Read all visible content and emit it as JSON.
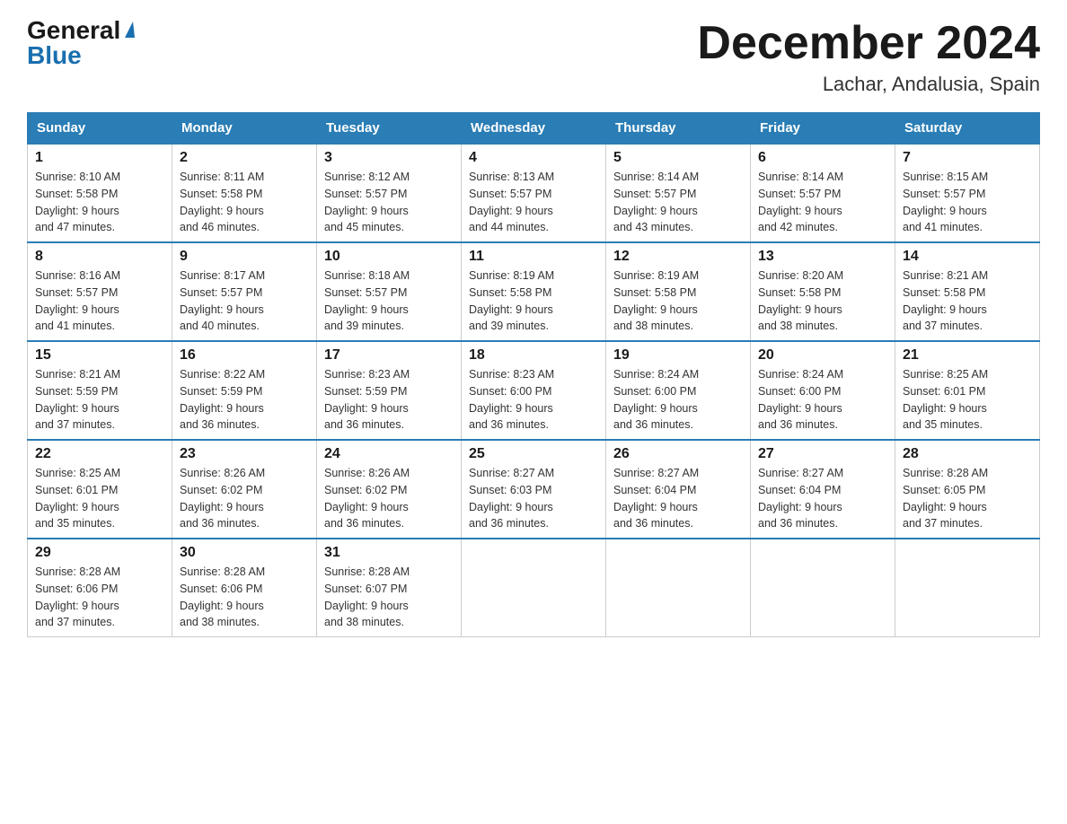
{
  "header": {
    "logo_general": "General",
    "logo_blue": "Blue",
    "month_title": "December 2024",
    "location": "Lachar, Andalusia, Spain"
  },
  "weekdays": [
    "Sunday",
    "Monday",
    "Tuesday",
    "Wednesday",
    "Thursday",
    "Friday",
    "Saturday"
  ],
  "weeks": [
    [
      {
        "day": "1",
        "sunrise": "8:10 AM",
        "sunset": "5:58 PM",
        "daylight": "9 hours and 47 minutes."
      },
      {
        "day": "2",
        "sunrise": "8:11 AM",
        "sunset": "5:58 PM",
        "daylight": "9 hours and 46 minutes."
      },
      {
        "day": "3",
        "sunrise": "8:12 AM",
        "sunset": "5:57 PM",
        "daylight": "9 hours and 45 minutes."
      },
      {
        "day": "4",
        "sunrise": "8:13 AM",
        "sunset": "5:57 PM",
        "daylight": "9 hours and 44 minutes."
      },
      {
        "day": "5",
        "sunrise": "8:14 AM",
        "sunset": "5:57 PM",
        "daylight": "9 hours and 43 minutes."
      },
      {
        "day": "6",
        "sunrise": "8:14 AM",
        "sunset": "5:57 PM",
        "daylight": "9 hours and 42 minutes."
      },
      {
        "day": "7",
        "sunrise": "8:15 AM",
        "sunset": "5:57 PM",
        "daylight": "9 hours and 41 minutes."
      }
    ],
    [
      {
        "day": "8",
        "sunrise": "8:16 AM",
        "sunset": "5:57 PM",
        "daylight": "9 hours and 41 minutes."
      },
      {
        "day": "9",
        "sunrise": "8:17 AM",
        "sunset": "5:57 PM",
        "daylight": "9 hours and 40 minutes."
      },
      {
        "day": "10",
        "sunrise": "8:18 AM",
        "sunset": "5:57 PM",
        "daylight": "9 hours and 39 minutes."
      },
      {
        "day": "11",
        "sunrise": "8:19 AM",
        "sunset": "5:58 PM",
        "daylight": "9 hours and 39 minutes."
      },
      {
        "day": "12",
        "sunrise": "8:19 AM",
        "sunset": "5:58 PM",
        "daylight": "9 hours and 38 minutes."
      },
      {
        "day": "13",
        "sunrise": "8:20 AM",
        "sunset": "5:58 PM",
        "daylight": "9 hours and 38 minutes."
      },
      {
        "day": "14",
        "sunrise": "8:21 AM",
        "sunset": "5:58 PM",
        "daylight": "9 hours and 37 minutes."
      }
    ],
    [
      {
        "day": "15",
        "sunrise": "8:21 AM",
        "sunset": "5:59 PM",
        "daylight": "9 hours and 37 minutes."
      },
      {
        "day": "16",
        "sunrise": "8:22 AM",
        "sunset": "5:59 PM",
        "daylight": "9 hours and 36 minutes."
      },
      {
        "day": "17",
        "sunrise": "8:23 AM",
        "sunset": "5:59 PM",
        "daylight": "9 hours and 36 minutes."
      },
      {
        "day": "18",
        "sunrise": "8:23 AM",
        "sunset": "6:00 PM",
        "daylight": "9 hours and 36 minutes."
      },
      {
        "day": "19",
        "sunrise": "8:24 AM",
        "sunset": "6:00 PM",
        "daylight": "9 hours and 36 minutes."
      },
      {
        "day": "20",
        "sunrise": "8:24 AM",
        "sunset": "6:00 PM",
        "daylight": "9 hours and 36 minutes."
      },
      {
        "day": "21",
        "sunrise": "8:25 AM",
        "sunset": "6:01 PM",
        "daylight": "9 hours and 35 minutes."
      }
    ],
    [
      {
        "day": "22",
        "sunrise": "8:25 AM",
        "sunset": "6:01 PM",
        "daylight": "9 hours and 35 minutes."
      },
      {
        "day": "23",
        "sunrise": "8:26 AM",
        "sunset": "6:02 PM",
        "daylight": "9 hours and 36 minutes."
      },
      {
        "day": "24",
        "sunrise": "8:26 AM",
        "sunset": "6:02 PM",
        "daylight": "9 hours and 36 minutes."
      },
      {
        "day": "25",
        "sunrise": "8:27 AM",
        "sunset": "6:03 PM",
        "daylight": "9 hours and 36 minutes."
      },
      {
        "day": "26",
        "sunrise": "8:27 AM",
        "sunset": "6:04 PM",
        "daylight": "9 hours and 36 minutes."
      },
      {
        "day": "27",
        "sunrise": "8:27 AM",
        "sunset": "6:04 PM",
        "daylight": "9 hours and 36 minutes."
      },
      {
        "day": "28",
        "sunrise": "8:28 AM",
        "sunset": "6:05 PM",
        "daylight": "9 hours and 37 minutes."
      }
    ],
    [
      {
        "day": "29",
        "sunrise": "8:28 AM",
        "sunset": "6:06 PM",
        "daylight": "9 hours and 37 minutes."
      },
      {
        "day": "30",
        "sunrise": "8:28 AM",
        "sunset": "6:06 PM",
        "daylight": "9 hours and 38 minutes."
      },
      {
        "day": "31",
        "sunrise": "8:28 AM",
        "sunset": "6:07 PM",
        "daylight": "9 hours and 38 minutes."
      },
      null,
      null,
      null,
      null
    ]
  ],
  "labels": {
    "sunrise": "Sunrise:",
    "sunset": "Sunset:",
    "daylight": "Daylight:"
  }
}
